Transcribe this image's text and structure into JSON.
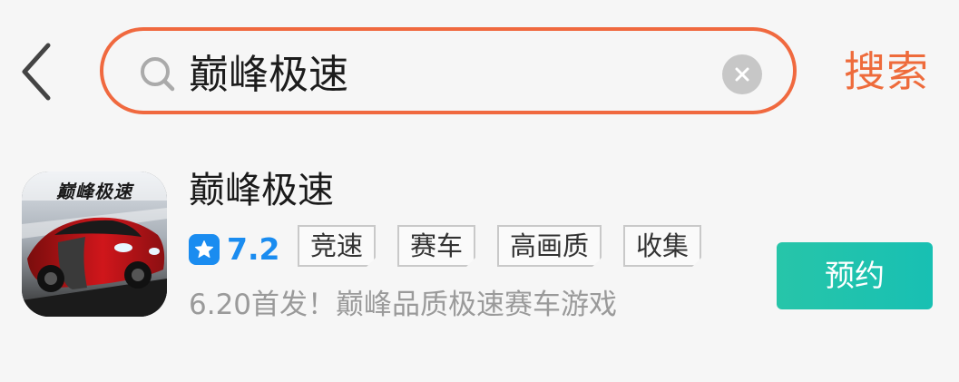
{
  "header": {
    "back_icon": "chevron-left-icon",
    "search": {
      "icon": "search-icon",
      "value": "巅峰极速",
      "placeholder": "",
      "clear_icon": "clear-icon"
    },
    "search_button_label": "搜索"
  },
  "results": [
    {
      "icon_title": "巅峰极速",
      "name": "巅峰极速",
      "rating_icon": "star-icon",
      "rating": "7.2",
      "tags": [
        "竞速",
        "赛车",
        "高画质",
        "收集"
      ],
      "description": "6.20首发！巅峰品质极速赛车游戏",
      "action_label": "预约"
    }
  ],
  "colors": {
    "accent": "#ee6b3b",
    "rating_blue": "#1a8cf0",
    "action_teal": "#1fc3ae",
    "background": "#f6f6f6",
    "muted_text": "#9a9a9a"
  }
}
